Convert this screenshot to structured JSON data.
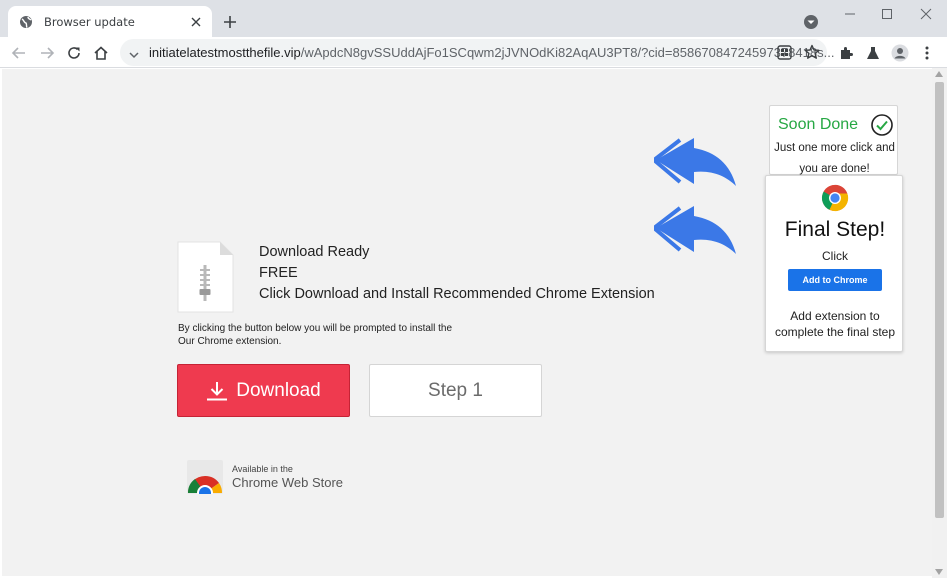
{
  "tab": {
    "title": "Browser update"
  },
  "address_bar": {
    "host": "initiatelatestmostthefile.vip",
    "path": "/wApdcN8gvSSUddAjFo1SCqwm2jJVNOdKi82AqAU3PT8/?cid=85867084724597378418s..."
  },
  "page": {
    "headline": [
      "Download Ready",
      "FREE",
      "Click Download and Install Recommended Chrome Extension"
    ],
    "disclaimer_line1": "By clicking the button below you will be prompted to install the",
    "disclaimer_line2": "Our Chrome extension.",
    "download_label": "Download",
    "step_label": "Step 1",
    "webstore_small": "Available in the",
    "webstore_big": "Chrome Web Store"
  },
  "soon_card": {
    "title": "Soon Done",
    "line1": "Just one more click and",
    "line2": "you are done!"
  },
  "final_card": {
    "title": "Final Step!",
    "click_label": "Click",
    "button_label": "Add to Chrome",
    "line1": "Add extension to",
    "line2": "complete the final step"
  },
  "colors": {
    "download_red": "#ef3a4f",
    "success_green": "#27a844",
    "arrow_blue": "#3b78e7",
    "chrome_button_blue": "#1a73e8"
  },
  "icons": [
    "globe-icon",
    "close-icon",
    "plus-icon",
    "tab-search-icon",
    "minimize-icon",
    "maximize-icon",
    "window-close-icon",
    "back-arrow-icon",
    "forward-arrow-icon",
    "reload-icon",
    "home-icon",
    "site-info-icon",
    "qr-code-icon",
    "star-icon",
    "extensions-icon",
    "labs-flask-icon",
    "profile-avatar-icon",
    "kebab-menu-icon",
    "zip-file-icon",
    "download-icon",
    "check-circle-icon",
    "chrome-logo-icon",
    "double-arrow-icon"
  ]
}
